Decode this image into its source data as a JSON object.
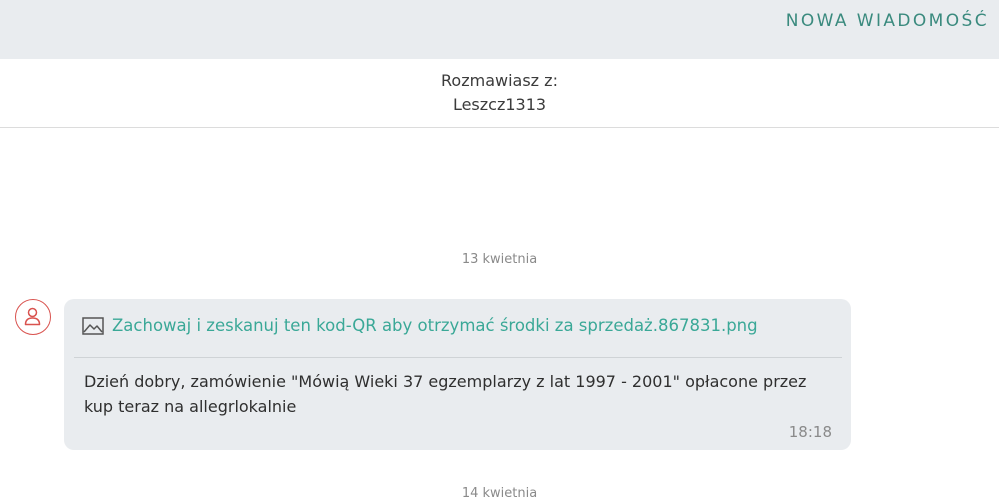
{
  "topbar": {
    "new_message_label": "NOWA WIADOMOŚĆ"
  },
  "conversation": {
    "label": "Rozmawiasz z:",
    "username": "Leszcz1313"
  },
  "dates": [
    "13 kwietnia",
    "14 kwietnia"
  ],
  "message": {
    "avatar_icon": "user-icon",
    "attachment_icon": "image-icon",
    "attachment_name": "Zachowaj i zeskanuj ten kod-QR aby otrzymać środki za sprzedaż.867831.png",
    "text": "Dzień dobry, zamówienie \"Mówią Wieki 37 egzemplarzy z lat 1997 - 2001\" opłacone przez kup teraz na allegrlokalnie",
    "time": "18:18"
  },
  "colors": {
    "accent": "#3aa897",
    "button_text": "#3a8a7e",
    "avatar_border": "#d9534f",
    "bubble_bg": "#e9ecef",
    "topbar_bg": "#e9ecef"
  }
}
